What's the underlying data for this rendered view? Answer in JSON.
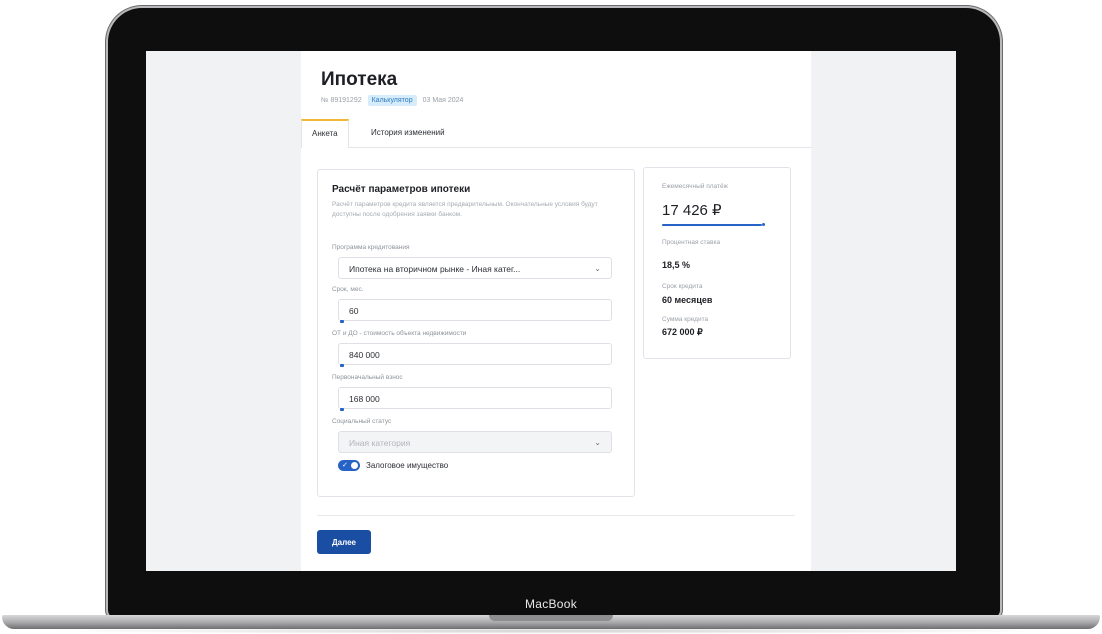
{
  "device": {
    "label": "MacBook"
  },
  "page": {
    "title": "Ипотека",
    "number": "№ 89191292",
    "badge": "Калькулятор",
    "date": "03 Мая 2024"
  },
  "tabs": [
    {
      "label": "Анкета",
      "active": true
    },
    {
      "label": "История изменений",
      "active": false
    }
  ],
  "form": {
    "title": "Расчёт параметров ипотеки",
    "description": "Расчёт параметров кредита является предварительным. Окончательные условия будут доступны после одобрения заявки банком.",
    "program": {
      "label": "Программа кредитования",
      "value": "Ипотека на вторичном рынке - Иная катег..."
    },
    "term": {
      "label": "Срок, мес.",
      "value": "60"
    },
    "property_value": {
      "label": "ОТ и ДО - стоимость объекта недвижимости",
      "value": "840 000"
    },
    "down_payment": {
      "label": "Первоначальный взнос",
      "value": "168 000"
    },
    "social_status": {
      "label": "Социальный статус",
      "value": "Иная категория"
    },
    "collateral": {
      "label": "Залоговое имущество",
      "checked": true
    }
  },
  "summary": {
    "monthly_label": "Ежемесячный платёж",
    "monthly_value": "17 426 ₽",
    "rate_label": "Процентная ставка",
    "rate_value": "18,5 %",
    "term_label": "Срок кредита",
    "term_value": "60 месяцев",
    "amount_label": "Сумма кредита",
    "amount_value": "672 000 ₽"
  },
  "actions": {
    "next_label": "Далее"
  },
  "colors": {
    "accent": "#1a4ea3",
    "tab_indicator": "#f1b63a",
    "badge_bg": "#d7ecfa"
  }
}
